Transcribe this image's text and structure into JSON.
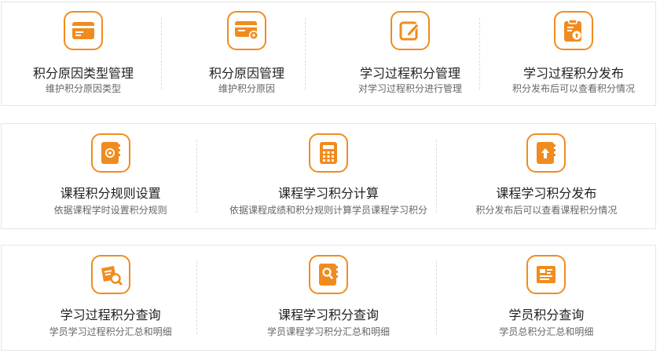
{
  "accent_color": "#f08c1f",
  "rows": [
    {
      "cards": [
        {
          "icon": "card-icon",
          "title": "积分原因类型管理",
          "desc": "维护积分原因类型"
        },
        {
          "icon": "card-settings-icon",
          "title": "积分原因管理",
          "desc": "维护积分原因"
        },
        {
          "icon": "edit-icon",
          "title": "学习过程积分管理",
          "desc": "对学习过程积分进行管理"
        },
        {
          "icon": "clipboard-upload-icon",
          "title": "学习过程积分发布",
          "desc": "积分发布后可以查看积分情况"
        }
      ]
    },
    {
      "cards": [
        {
          "icon": "book-gear-icon",
          "title": "课程积分规则设置",
          "desc": "依据课程学时设置积分规则"
        },
        {
          "icon": "calculator-icon",
          "title": "课程学习积分计算",
          "desc": "依据课程成绩和积分规则计算学员课程学习积分"
        },
        {
          "icon": "book-upload-icon",
          "title": "课程学习积分发布",
          "desc": "积分发布后可以查看课程积分情况"
        }
      ]
    },
    {
      "cards": [
        {
          "icon": "document-search-icon",
          "title": "学习过程积分查询",
          "desc": "学员学习过程积分汇总和明细"
        },
        {
          "icon": "book-search-icon",
          "title": "课程学习积分查询",
          "desc": "学员课程学习积分汇总和明细"
        },
        {
          "icon": "newspaper-icon",
          "title": "学员积分查询",
          "desc": "学员总积分汇总和明细"
        }
      ]
    }
  ]
}
